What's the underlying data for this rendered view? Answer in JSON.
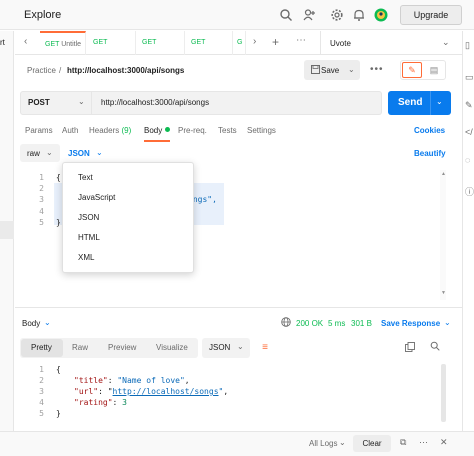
{
  "app": {
    "title": "Explore",
    "upgrade_label": "Upgrade"
  },
  "left_stub": {
    "label": "rt"
  },
  "tabs": [
    {
      "method": "GET",
      "name": "Untitle"
    },
    {
      "method": "GET",
      "name": ""
    },
    {
      "method": "GET",
      "name": ""
    },
    {
      "method": "GET",
      "name": ""
    },
    {
      "method": "G",
      "name": ""
    }
  ],
  "environment": {
    "label": "Uvote"
  },
  "breadcrumb": {
    "parent": "Practice",
    "separator": "/",
    "current": "http://localhost:3000/api/songs"
  },
  "toolbar": {
    "save_label": "Save",
    "more_label": "•••"
  },
  "request": {
    "method": "POST",
    "url": "http://localhost:3000/api/songs",
    "send_label": "Send",
    "tabs": [
      {
        "label": "Params"
      },
      {
        "label": "Auth"
      },
      {
        "label": "Headers",
        "count": "(9)"
      },
      {
        "label": "Body"
      },
      {
        "label": "Pre-req."
      },
      {
        "label": "Tests"
      },
      {
        "label": "Settings"
      }
    ],
    "cookies_label": "Cookies",
    "body_type": "raw",
    "body_language": "JSON",
    "beautify_label": "Beautify",
    "editor_lines": [
      "1",
      "2",
      "3",
      "4",
      "5"
    ],
    "editor_code": {
      "line1": "{",
      "line3": "ongs\",",
      "line5": "}"
    }
  },
  "language_dropdown": {
    "options": [
      "Text",
      "JavaScript",
      "JSON",
      "HTML",
      "XML"
    ]
  },
  "response": {
    "body_label": "Body",
    "status": "200 OK",
    "time": "5 ms",
    "size": "301 B",
    "save_label": "Save Response",
    "view_tabs": [
      "Pretty",
      "Raw",
      "Preview",
      "Visualize"
    ],
    "format": "JSON",
    "line_numbers": [
      "1",
      "2",
      "3",
      "4",
      "5"
    ],
    "json": {
      "open": "{",
      "title_key": "\"title\"",
      "title_val": "\"Name of love\"",
      "url_key": "\"url\"",
      "url_val": "http://localhost/songs",
      "rating_key": "\"rating\"",
      "rating_val": "3",
      "close": "}"
    }
  },
  "statusbar": {
    "logs_label": "All Logs",
    "clear_label": "Clear"
  },
  "colors": {
    "accent": "#ff6c37",
    "primary": "#097bed",
    "success": "#0cbb52"
  },
  "icons": [
    "search-icon",
    "add-user-icon",
    "settings-icon",
    "bell-icon",
    "avatar-icon",
    "copy-icon",
    "wrap-icon",
    "globe-icon"
  ]
}
